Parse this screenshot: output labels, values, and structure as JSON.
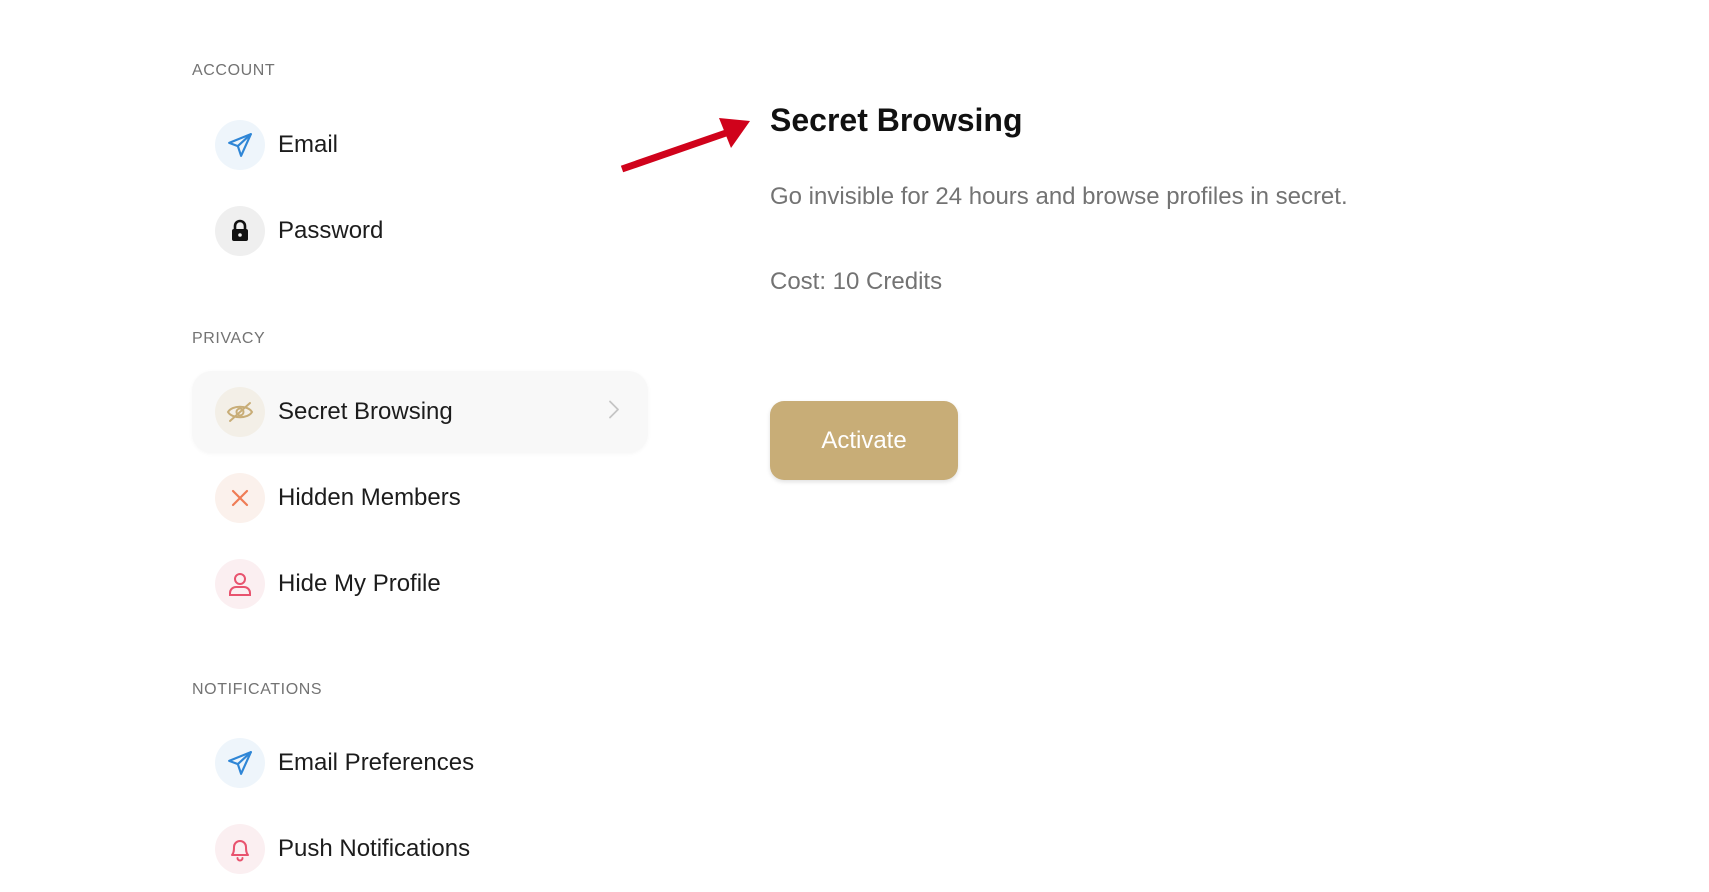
{
  "sidebar": {
    "sections": [
      {
        "label": "ACCOUNT",
        "items": [
          {
            "label": "Email",
            "icon": "paper-plane-icon",
            "icon_color": "#2f86d6"
          },
          {
            "label": "Password",
            "icon": "lock-icon",
            "icon_color": "#111111"
          }
        ]
      },
      {
        "label": "PRIVACY",
        "items": [
          {
            "label": "Secret Browsing",
            "icon": "eye-slash-icon",
            "icon_color": "#c8ad77",
            "active": true
          },
          {
            "label": "Hidden Members",
            "icon": "close-icon",
            "icon_color": "#ef7c55"
          },
          {
            "label": "Hide My Profile",
            "icon": "user-icon",
            "icon_color": "#e8536e"
          }
        ]
      },
      {
        "label": "NOTIFICATIONS",
        "items": [
          {
            "label": "Email Preferences",
            "icon": "paper-plane-icon",
            "icon_color": "#2f86d6"
          },
          {
            "label": "Push Notifications",
            "icon": "bell-icon",
            "icon_color": "#e8536e"
          }
        ]
      }
    ]
  },
  "detail": {
    "title": "Secret Browsing",
    "description": "Go invisible for 24 hours and browse profiles in secret.",
    "cost": "Cost: 10 Credits",
    "button_label": "Activate"
  },
  "colors": {
    "accent": "#c8ad77",
    "annotation_arrow": "#d0021b",
    "muted_text": "#737373"
  }
}
